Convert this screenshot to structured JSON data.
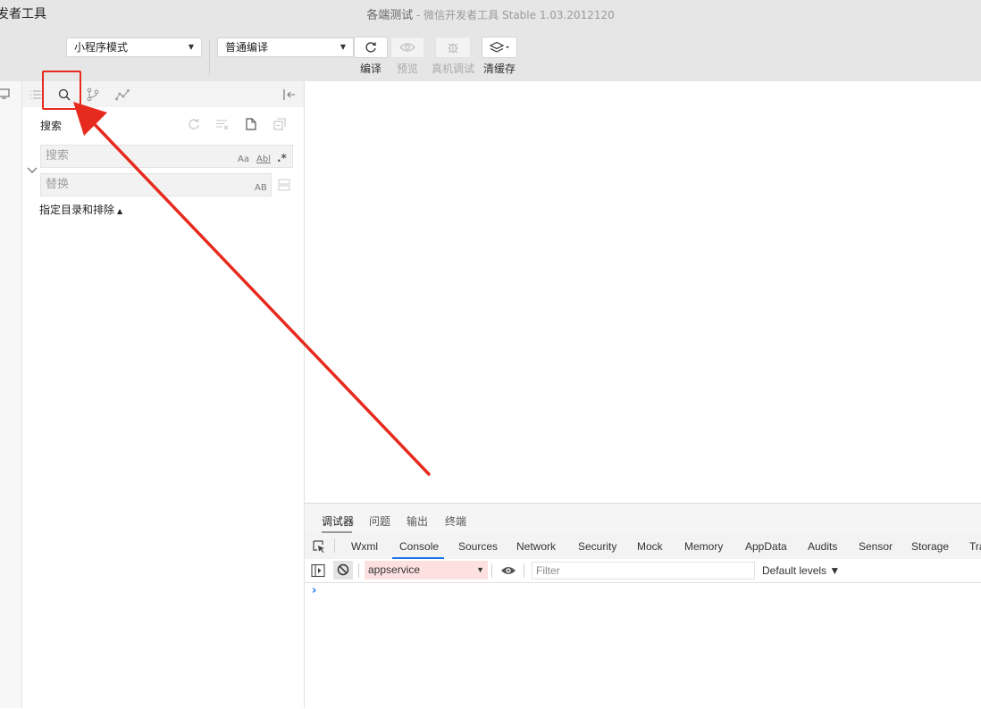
{
  "window": {
    "app_name": "发者工具",
    "title_project": "各端测试",
    "title_rest": " - 微信开发者工具 Stable 1.03.2012120"
  },
  "toolbar": {
    "mode_select": "小程序模式",
    "compile_select": "普通编译",
    "compile_label": "编译",
    "preview_label": "预览",
    "real_debug_label": "真机调试",
    "clear_cache_label": "清缓存"
  },
  "search_panel": {
    "title": "搜索",
    "search_placeholder": "搜索",
    "replace_placeholder": "替换",
    "opt_match_case": "Aa",
    "opt_whole_word": "Abl",
    "opt_regex": ".*",
    "opt_preserve_case": "AB",
    "include_exclude": "指定目录和排除"
  },
  "devtools": {
    "top_tabs": [
      "调试器",
      "问题",
      "输出",
      "终端"
    ],
    "tabs": [
      "Wxml",
      "Console",
      "Sources",
      "Network",
      "Security",
      "Mock",
      "Memory",
      "AppData",
      "Audits",
      "Sensor",
      "Storage",
      "Tra"
    ],
    "active_tab": "Console",
    "context": "appservice",
    "filter_placeholder": "Filter",
    "levels": "Default levels ▼",
    "prompt": "›"
  },
  "colors": {
    "annotation": "#e62b1e",
    "console_active": "#1a73e8",
    "context_bg": "#fde0e0"
  }
}
